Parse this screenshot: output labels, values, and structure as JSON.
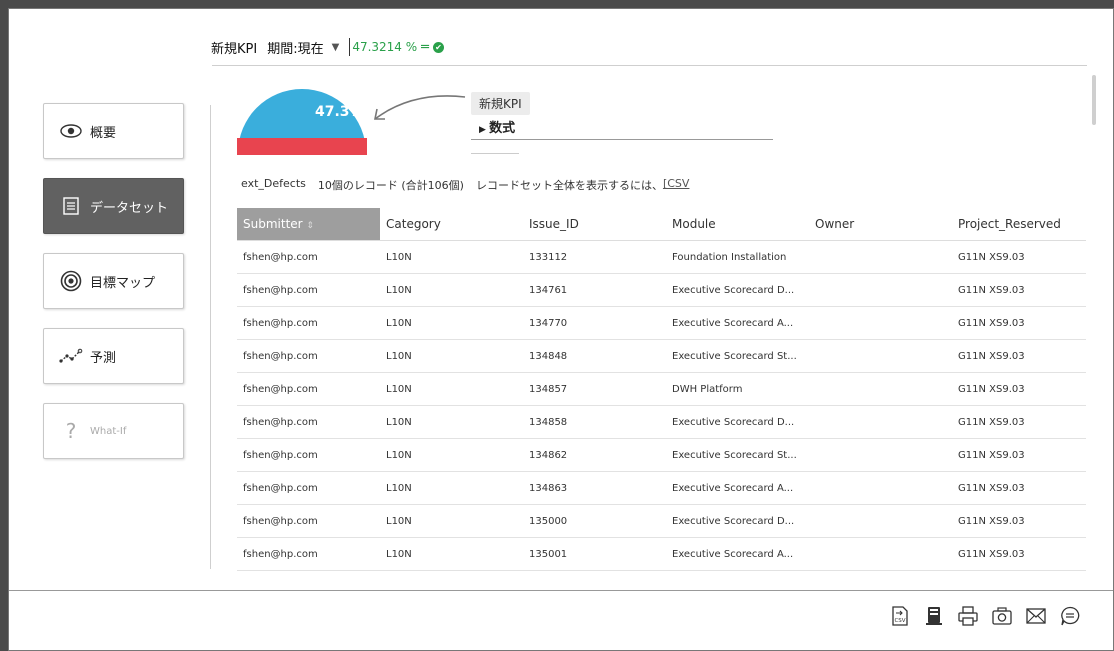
{
  "header": {
    "kpi_label": "新規KPI",
    "period_label": "期間:",
    "period_value": "現在",
    "kpi_value": "47.3214 %",
    "status_color": "#2aa04a"
  },
  "nav": [
    {
      "label": "概要",
      "icon": "eye-icon"
    },
    {
      "label": "データセット",
      "icon": "document-list-icon",
      "active": true
    },
    {
      "label": "目標マップ",
      "icon": "target-icon"
    },
    {
      "label": "予測",
      "icon": "trend-line-icon"
    },
    {
      "label": "What-If",
      "icon": "question-icon",
      "disabled": true
    }
  ],
  "pie": {
    "value_label": "47.3%",
    "fill_color": "#3aaedc",
    "remainder_color": "#e8444f"
  },
  "formula": {
    "title": "新規KPI",
    "toggle_label": "数式"
  },
  "info": {
    "dataset_name": "ext_Defects",
    "record_count": "10個のレコード (合計106個)",
    "hint": "レコードセット全体を表示するには、",
    "csv_link": "[CSV"
  },
  "table": {
    "columns": [
      "Submitter",
      "Category",
      "Issue_ID",
      "Module",
      "Owner",
      "Project_Reserved"
    ],
    "rows": [
      [
        "fshen@hp.com",
        "L10N",
        "133112",
        "Foundation Installation",
        "",
        "G11N XS9.03"
      ],
      [
        "fshen@hp.com",
        "L10N",
        "134761",
        "Executive Scorecard D...",
        "",
        "G11N XS9.03"
      ],
      [
        "fshen@hp.com",
        "L10N",
        "134770",
        "Executive Scorecard A...",
        "",
        "G11N XS9.03"
      ],
      [
        "fshen@hp.com",
        "L10N",
        "134848",
        "Executive Scorecard St...",
        "",
        "G11N XS9.03"
      ],
      [
        "fshen@hp.com",
        "L10N",
        "134857",
        "DWH Platform",
        "",
        "G11N XS9.03"
      ],
      [
        "fshen@hp.com",
        "L10N",
        "134858",
        "Executive Scorecard D...",
        "",
        "G11N XS9.03"
      ],
      [
        "fshen@hp.com",
        "L10N",
        "134862",
        "Executive Scorecard St...",
        "",
        "G11N XS9.03"
      ],
      [
        "fshen@hp.com",
        "L10N",
        "134863",
        "Executive Scorecard A...",
        "",
        "G11N XS9.03"
      ],
      [
        "fshen@hp.com",
        "L10N",
        "135000",
        "Executive Scorecard D...",
        "",
        "G11N XS9.03"
      ],
      [
        "fshen@hp.com",
        "L10N",
        "135001",
        "Executive Scorecard A...",
        "",
        "G11N XS9.03"
      ]
    ]
  },
  "footer": {
    "icons": [
      "csv-export-icon",
      "database-icon",
      "print-icon",
      "camera-icon",
      "mail-icon",
      "comment-icon"
    ],
    "csv_icon_text": "CSV"
  }
}
